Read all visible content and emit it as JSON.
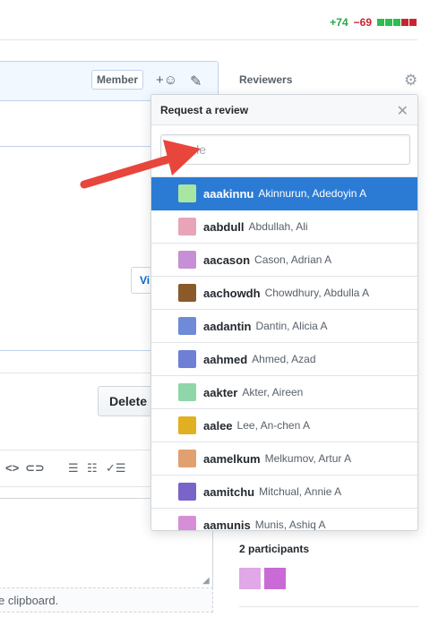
{
  "diffstat": {
    "additions": "+74",
    "deletions": "−69",
    "blocks": [
      "#2cbe4e",
      "#2cbe4e",
      "#2cbe4e",
      "#cb2431",
      "#cb2431"
    ]
  },
  "comment": {
    "member_badge": "Member",
    "react_icon": "smiley-icon",
    "edit_icon": "pencil-icon",
    "view_button": "Vi"
  },
  "actions": {
    "delete_button": "Delete"
  },
  "toolbar": {
    "icons": [
      "code-icon",
      "link-icon",
      "unordered-list-icon",
      "ordered-list-icon",
      "task-list-icon"
    ]
  },
  "editor": {
    "clipboard_hint": "e clipboard."
  },
  "sidebar": {
    "reviewers_label": "Reviewers",
    "participants_label": "2 participants"
  },
  "popover": {
    "title": "Request a review",
    "filter_placeholder": "people",
    "users": [
      {
        "login": "aaakinnu",
        "name": "Akinnurun, Adedoyin A",
        "selected": true,
        "avatar_color": "#a8e6a1"
      },
      {
        "login": "aabdull",
        "name": "Abdullah, Ali",
        "selected": false,
        "avatar_color": "#e8a5b8"
      },
      {
        "login": "aacason",
        "name": "Cason, Adrian A",
        "selected": false,
        "avatar_color": "#c78fd6"
      },
      {
        "login": "aachowdh",
        "name": "Chowdhury, Abdulla A",
        "selected": false,
        "avatar_color": "#8a5a2b"
      },
      {
        "login": "aadantin",
        "name": "Dantin, Alicia A",
        "selected": false,
        "avatar_color": "#6f8ad6"
      },
      {
        "login": "aahmed",
        "name": "Ahmed, Azad",
        "selected": false,
        "avatar_color": "#6f7fd6"
      },
      {
        "login": "aakter",
        "name": "Akter, Aireen",
        "selected": false,
        "avatar_color": "#8fd6a8"
      },
      {
        "login": "aalee",
        "name": "Lee, An-chen A",
        "selected": false,
        "avatar_color": "#e0b020"
      },
      {
        "login": "aamelkum",
        "name": "Melkumov, Artur A",
        "selected": false,
        "avatar_color": "#e0a070"
      },
      {
        "login": "aamitchu",
        "name": "Mitchual, Annie A",
        "selected": false,
        "avatar_color": "#7a63c9"
      },
      {
        "login": "aamunis",
        "name": "Munis, Ashiq A",
        "selected": false,
        "avatar_color": "#d68fd6"
      }
    ]
  },
  "participants": [
    {
      "avatar_color": "#e0a8e6"
    },
    {
      "avatar_color": "#c96ad6"
    }
  ]
}
